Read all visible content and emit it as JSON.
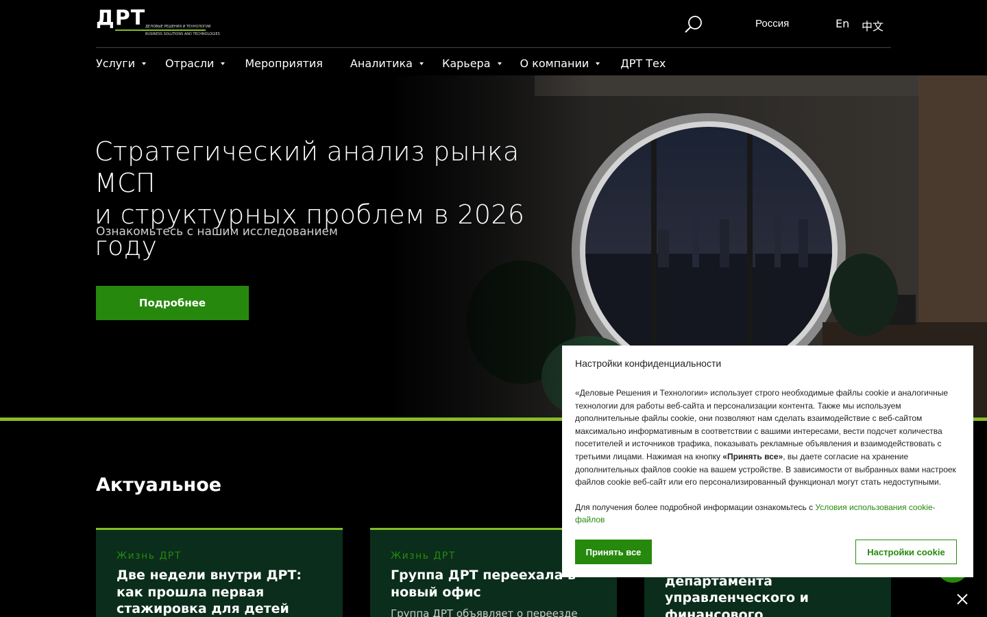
{
  "header": {
    "logo_text": "ДРТ",
    "logo_sub_ru": "ДЕЛОВЫЕ РЕШЕНИЯ И ТЕХНОЛОГИИ",
    "logo_sub_en": "BUSINESS SOLUTIONS AND TECHNOLOGIES",
    "region": "Россия",
    "lang_en": "En",
    "lang_zh": "中文",
    "search_icon": "search-icon"
  },
  "nav": {
    "items": [
      {
        "label": "Услуги",
        "dropdown": true
      },
      {
        "label": "Отрасли",
        "dropdown": true
      },
      {
        "label": "Мероприятия",
        "dropdown": false
      },
      {
        "label": "Аналитика",
        "dropdown": true
      },
      {
        "label": "Карьера",
        "dropdown": true
      },
      {
        "label": "О компании",
        "dropdown": true
      },
      {
        "label": "ДРТ Тех",
        "dropdown": false
      }
    ]
  },
  "hero": {
    "title_line1": "Стратегический анализ рынка МСП",
    "title_line2": "и структурных проблем в 2026 году",
    "subtitle": "Ознакомьтесь с нашим исследованием",
    "button_label": "Подробнее"
  },
  "actual": {
    "title": "Актуальное",
    "cards": [
      {
        "category": "Жизнь ДРТ",
        "title": "Две недели внутри ДРТ: как прошла первая стажировка для детей сотрудников",
        "desc": ""
      },
      {
        "category": "Жизнь ДРТ",
        "title": "Группа ДРТ переехала в новый офис",
        "desc": "Группа ДРТ объявляет о переезде"
      },
      {
        "category": "",
        "title": "Новый партнер департамента управленческого и финансового",
        "desc": ""
      }
    ]
  },
  "cookie": {
    "title": "Настройки конфиденциальности",
    "text_before": "«Деловые Решения и Технологии» использует строго необходимые файлы cookie и аналогичные технологии для работы веб-сайта и персонализации контента. Также мы используем дополнительные файлы cookie, они позволяют нам сделать взаимодействие с веб-сайтом максимально информативным в соответствии с вашими интересами, вести подсчет количества посетителей и источников трафика, показывать рекламные объявления и взаимодействовать с третьими лицами. Нажимая на кнопку ",
    "text_bold": "«Принять все»",
    "text_after": ", вы даете согласие на хранение дополнительных файлов cookie на вашем устройстве. В зависимости от выбранных вами настроек файлов cookie веб-сайт или его персонализированный функционал могут стать недоступными.",
    "more_text": "Для получения более подробной информации ознакомьтесь с ",
    "more_link": "Условия использования cookie-файлов",
    "accept_label": "Принять все",
    "settings_label": "Настройки cookie"
  },
  "colors": {
    "accent_green": "#26890d",
    "lime": "#86bc25",
    "card_bg": "#0b2d1c"
  }
}
